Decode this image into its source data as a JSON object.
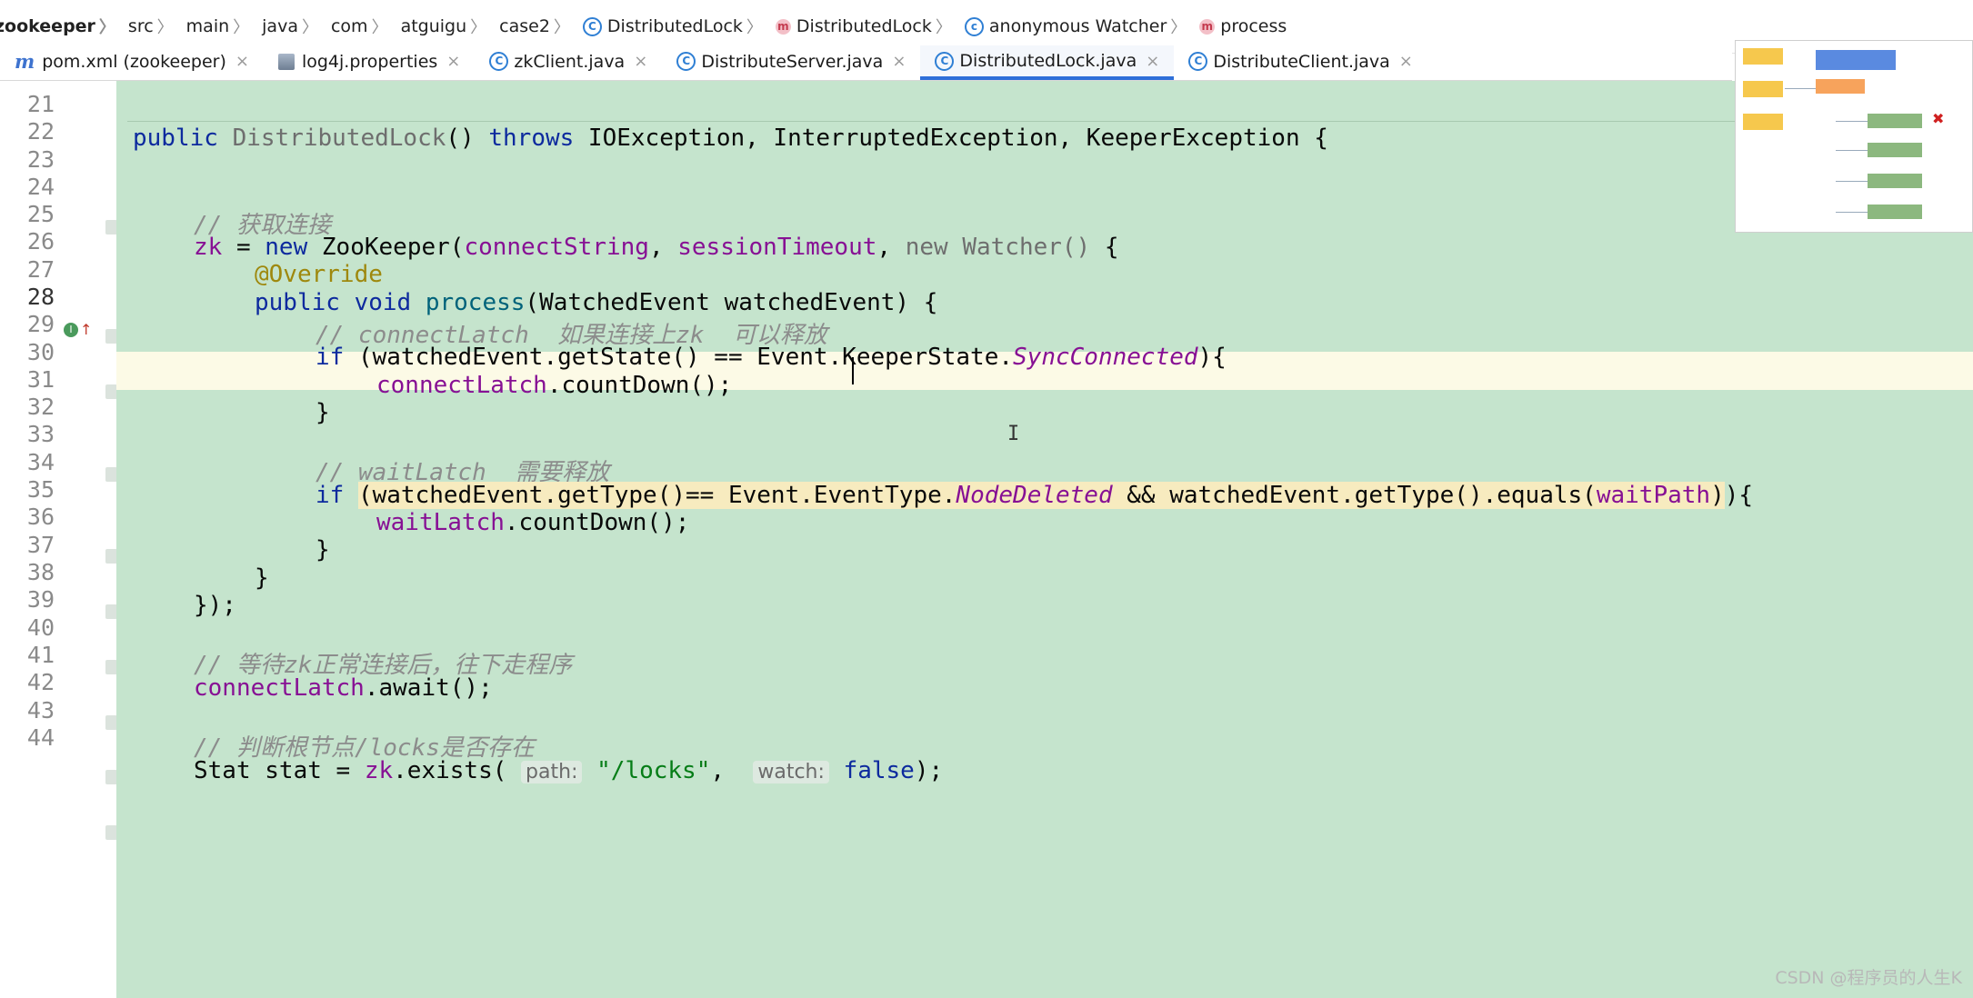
{
  "breadcrumb": {
    "project": "zookeeper",
    "items": [
      "src",
      "main",
      "java",
      "com",
      "atguigu",
      "case2"
    ],
    "class1": "DistributedLock",
    "method1": "DistributedLock",
    "anon": "anonymous Watcher",
    "method2": "process"
  },
  "tabs": [
    {
      "label": "pom.xml (zookeeper)",
      "icon": "maven-icon"
    },
    {
      "label": "log4j.properties",
      "icon": "properties-icon"
    },
    {
      "label": "zkClient.java",
      "icon": "class-icon"
    },
    {
      "label": "DistributeServer.java",
      "icon": "class-icon"
    },
    {
      "label": "DistributedLock.java",
      "icon": "class-icon",
      "active": true
    },
    {
      "label": "DistributeClient.java",
      "icon": "class-icon"
    }
  ],
  "editor": {
    "line_numbers": [
      "21",
      "22",
      "23",
      "24",
      "25",
      "26",
      "27",
      "28",
      "29",
      "30",
      "31",
      "32",
      "33",
      "34",
      "35",
      "36",
      "37",
      "38",
      "39",
      "40",
      "41",
      "42",
      "43",
      "44"
    ],
    "current_line": "28",
    "comments": {
      "l24": "// 获取连接",
      "l28": "// connectLatch  如果连接上zk  可以释放",
      "l33": "// waitLatch  需要释放",
      "l40": "// 等待zk正常连接后，往下走程序",
      "l43": "// 判断根节点/locks是否存在"
    },
    "hints": {
      "path": "path:",
      "watch": "watch:"
    },
    "strings": {
      "locks": "\"/locks\""
    }
  },
  "watermark": "CSDN @程序员的人生K",
  "colors": {
    "editor_bg": "#c5e4cd",
    "keyword": "#0d2a9e",
    "field": "#871094",
    "comment": "#8c8c8c",
    "annotation": "#9e880d",
    "caret_line": "#fcfae6"
  }
}
